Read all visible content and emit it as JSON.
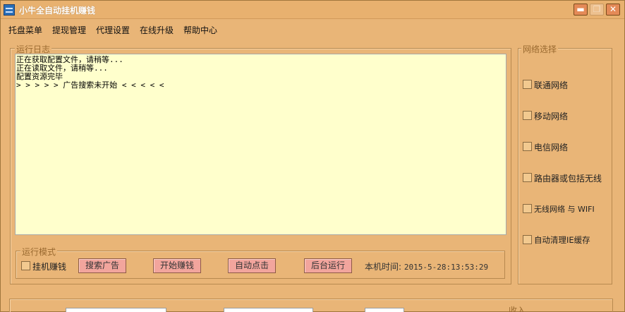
{
  "window": {
    "title": "小牛全自动挂机赚钱",
    "minimize": "▬",
    "maximize": "❐",
    "close": "✕"
  },
  "menu": [
    "托盘菜单",
    "提现管理",
    "代理设置",
    "在线升级",
    "帮助中心"
  ],
  "log": {
    "legend": "运行日志",
    "lines": [
      "正在获取配置文件，请稍等...",
      "正在读取文件，请稍等...",
      "配置资源完毕",
      "> > > > > 广告搜索未开始 < < < < <"
    ]
  },
  "network": {
    "legend": "网络选择",
    "options": [
      {
        "label": "联通网络",
        "checked": false
      },
      {
        "label": "移动网络",
        "checked": false
      },
      {
        "label": "电信网络",
        "checked": false
      },
      {
        "label": "路由器或包括无线",
        "checked": false
      },
      {
        "label": "无线网络 与 WIFI",
        "checked": false
      },
      {
        "label": "自动清理IE缓存",
        "checked": false
      }
    ]
  },
  "mode": {
    "legend": "运行模式",
    "checkbox_label": "挂机赚钱",
    "buttons": [
      "搜索广告",
      "开始赚钱",
      "自动点击",
      "后台运行"
    ],
    "time_label": "本机时间:",
    "time_value": "2015-5-28:13:53:29"
  },
  "bottom": {
    "collapse_text": "收入"
  },
  "colors": {
    "window_bg": "#e9b577",
    "log_bg": "#ffffcc",
    "button_bg": "#f2a59d",
    "legend_text": "#9a6a30"
  }
}
